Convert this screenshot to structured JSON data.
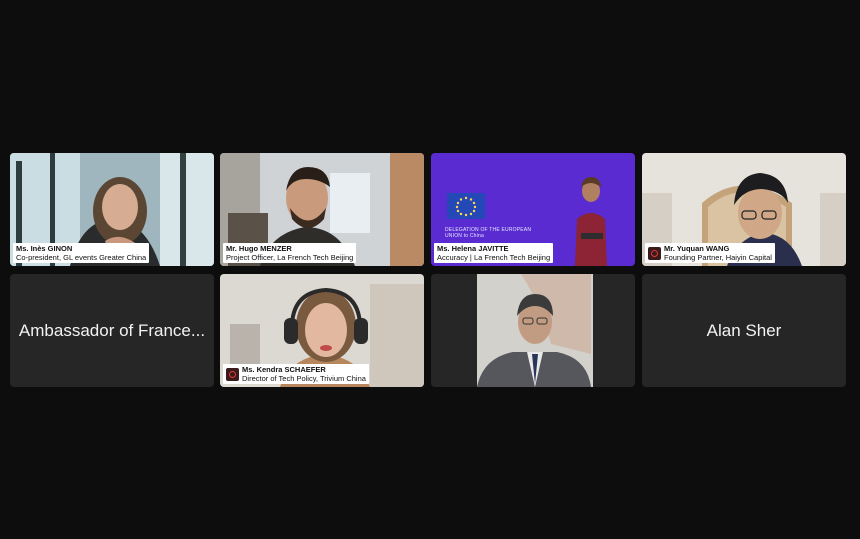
{
  "tiles": [
    {
      "id": "ines",
      "name": "Ms. Inès GINON",
      "role": "Co-president, GL events Greater China",
      "active": true
    },
    {
      "id": "hugo",
      "name": "Mr. Hugo MENZER",
      "role": "Project Officer, La French Tech Beijing"
    },
    {
      "id": "helena",
      "name": "Ms. Helena JAVITTE",
      "role": "Accuracy  |  La French Tech Beijing",
      "backdrop": "DELEGATION OF THE EUROPEAN UNION to China"
    },
    {
      "id": "yuquan",
      "name": "Mr. Yuquan WANG",
      "role": "Founding Partner, Haiyin Capital"
    },
    {
      "id": "ambassador",
      "display_name": "Ambassador of France..."
    },
    {
      "id": "kendra",
      "name": "Ms. Kendra SCHAEFER",
      "role": "Director of Tech Policy, Trivium China"
    },
    {
      "id": "speaker7"
    },
    {
      "id": "alan",
      "display_name": "Alan Sher"
    }
  ],
  "colors": {
    "background": "#0d0d0d",
    "tile": "#262626",
    "active_border": "#7ed957",
    "eu_purple": "#5a2bd0"
  }
}
